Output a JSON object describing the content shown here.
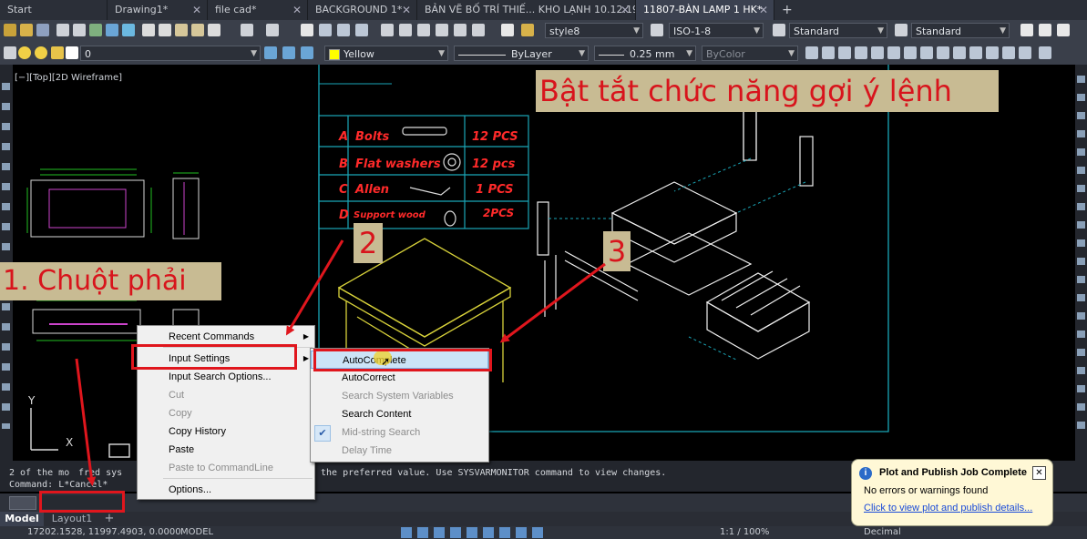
{
  "tabs": [
    {
      "label": "Start",
      "closable": false
    },
    {
      "label": "Drawing1*",
      "closable": true
    },
    {
      "label": "file cad*",
      "closable": true
    },
    {
      "label": "BACKGROUND 1*",
      "closable": true
    },
    {
      "label": "BẢN VẼ BỐ TRÍ THIẾ... KHO LẠNH 10.12.19*",
      "closable": true
    },
    {
      "label": "11807-BÀN LAMP 1 HK*",
      "closable": true,
      "active": true
    }
  ],
  "new_tab_icon": "+",
  "toolbar1": {
    "text_style": "style8",
    "dim_style": "ISO-1-8",
    "table_style": "Standard",
    "mleader_style": "Standard"
  },
  "toolbar2": {
    "layer": "0",
    "color": "Yellow",
    "linetype": "ByLayer",
    "lineweight": "0.25 mm",
    "plotstyle": "ByColor"
  },
  "viewport_label": "[−][Top][2D Wireframe]",
  "annotations": {
    "title": "Bật tắt chức năng gợi ý lệnh",
    "step1": "1. Chuột phải",
    "step2": "2",
    "step3": "3"
  },
  "parts_table": [
    {
      "key": "A",
      "name": "Bolts",
      "qty": "12 PCS"
    },
    {
      "key": "B",
      "name": "Flat washers",
      "qty": "12 pcs"
    },
    {
      "key": "C",
      "name": "Allen",
      "qty": "1 PCS"
    },
    {
      "key": "D",
      "name": "Support wood",
      "qty": "2PCS"
    }
  ],
  "context_menu": [
    {
      "label": "Recent Commands",
      "submenu": true,
      "disabled": false
    },
    {
      "label": "Input Settings",
      "submenu": true,
      "disabled": false
    },
    {
      "label": "Input Search Options...",
      "disabled": false
    },
    {
      "label": "Cut",
      "disabled": true
    },
    {
      "label": "Copy",
      "disabled": true
    },
    {
      "label": "Copy History",
      "disabled": false
    },
    {
      "label": "Paste",
      "disabled": false
    },
    {
      "label": "Paste to CommandLine",
      "disabled": true
    },
    {
      "label": "Options...",
      "disabled": false
    }
  ],
  "submenu": [
    {
      "label": "AutoComplete",
      "checked": false,
      "disabled": false,
      "highlighted": true
    },
    {
      "label": "AutoCorrect",
      "checked": false,
      "disabled": false
    },
    {
      "label": "Search System Variables",
      "checked": false,
      "disabled": true
    },
    {
      "label": "Search Content",
      "checked": false,
      "disabled": false
    },
    {
      "label": "Mid-string Search",
      "checked": true,
      "disabled": true
    },
    {
      "label": "Delay Time",
      "checked": false,
      "disabled": true
    }
  ],
  "command_history": {
    "line1_left": "2 of the mo",
    "line1_mid": "fred sys",
    "line1_right": "the preferred value. Use SYSVARMONITOR command to view changes.",
    "line2": "Command: ",
    "line2_tail": "L*Cancel*"
  },
  "layout_tabs": [
    "Model",
    "Layout1",
    "+"
  ],
  "status": {
    "coords": "17202.1528, 11997.4903, 0.0000",
    "space": "MODEL",
    "scale": "1:1 / 100%",
    "units": "Decimal"
  },
  "notification": {
    "title": "Plot and Publish Job Complete",
    "body": "No errors or warnings found",
    "link": "Click to view plot and publish details..."
  },
  "axis": {
    "y": "Y",
    "x": "X"
  },
  "colors": {
    "accent_red": "#e0161d",
    "annotation_bg": "#c8bb93",
    "cad_cyan": "#1aa6b7",
    "cad_yellow": "#d8d23a"
  }
}
